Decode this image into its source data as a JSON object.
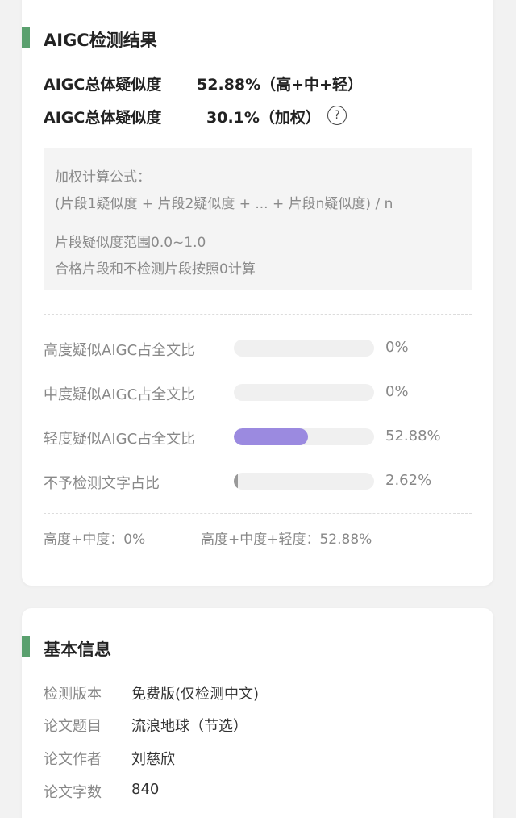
{
  "colors": {
    "accent_green": "#5aa06e",
    "bar_purple": "#9b8ae0",
    "bar_gray": "#999999",
    "track": "#f0f0f0"
  },
  "result_card": {
    "title": "AIGC检测结果",
    "metric1": {
      "label": "AIGC总体疑似度",
      "value": "52.88%（高+中+轻）"
    },
    "metric2": {
      "label": "AIGC总体疑似度",
      "value": "30.1%（加权）",
      "help_icon": "question-circle-icon",
      "help_glyph": "?"
    },
    "formula": {
      "title": "加权计算公式：",
      "expr": "(片段1疑似度 + 片段2疑似度 + ... + 片段n疑似度) / n",
      "range": "片段疑似度范围0.0~1.0",
      "note": "合格片段和不检测片段按照0计算"
    },
    "rows": [
      {
        "label": "高度疑似AIGC占全文比",
        "percent": "0%",
        "value": 0,
        "color": "#9b8ae0"
      },
      {
        "label": "中度疑似AIGC占全文比",
        "percent": "0%",
        "value": 0,
        "color": "#9b8ae0"
      },
      {
        "label": "轻度疑似AIGC占全文比",
        "percent": "52.88%",
        "value": 52.88,
        "color": "#9b8ae0"
      },
      {
        "label": "不予检测文字占比",
        "percent": "2.62%",
        "value": 2.62,
        "color": "#999999"
      }
    ],
    "summary": {
      "high_mid": "高度+中度：0%",
      "high_mid_low": "高度+中度+轻度：52.88%"
    }
  },
  "info_card": {
    "title": "基本信息",
    "items": [
      {
        "label": "检测版本",
        "value": "免费版(仅检测中文)"
      },
      {
        "label": "论文题目",
        "value": "流浪地球（节选）"
      },
      {
        "label": "论文作者",
        "value": "刘慈欣"
      },
      {
        "label": "论文字数",
        "value": "840"
      }
    ]
  }
}
